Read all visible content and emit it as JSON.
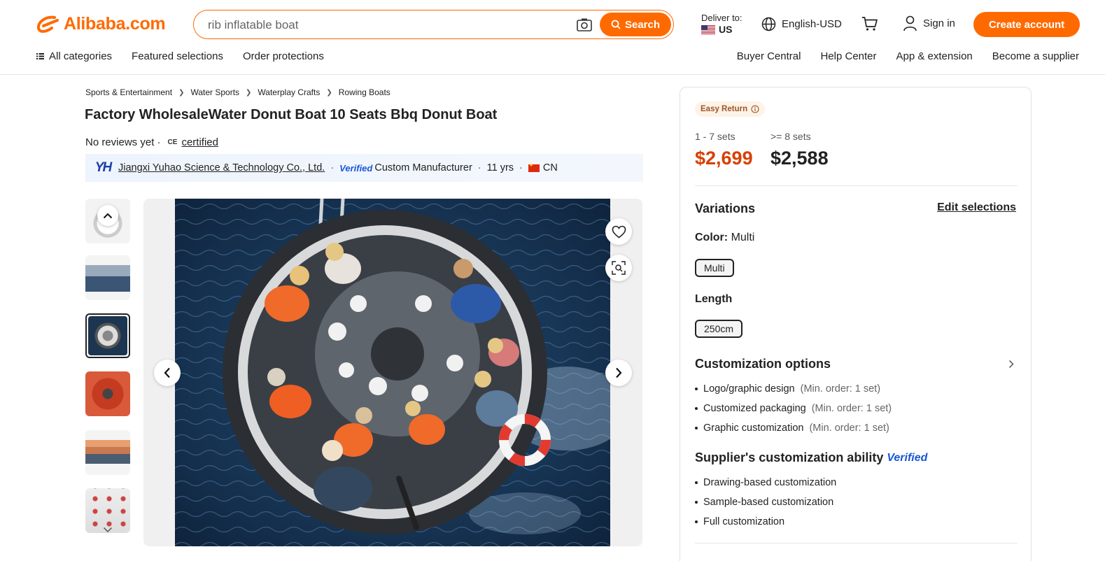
{
  "header": {
    "logo_text": "Alibaba.com",
    "search_placeholder": "rib inflatable boat",
    "search_button": "Search",
    "deliver_label": "Deliver to:",
    "deliver_country": "US",
    "language": "English-USD",
    "sign_in": "Sign in",
    "create_account": "Create account",
    "accent_color": "#ff6a00"
  },
  "nav": {
    "left": [
      "All categories",
      "Featured selections",
      "Order protections"
    ],
    "right": [
      "Buyer Central",
      "Help Center",
      "App & extension",
      "Become a supplier"
    ]
  },
  "breadcrumb": [
    "Sports & Entertainment",
    "Water Sports",
    "Waterplay Crafts",
    "Rowing Boats"
  ],
  "product": {
    "title": "Factory WholesaleWater Donut Boat 10 Seats Bbq Donut Boat",
    "reviews": "No reviews yet ·",
    "cert_mark": "CE",
    "certified": "certified"
  },
  "supplier": {
    "logo_text": "YH",
    "name": "Jiangxi Yuhao Science & Technology Co., Ltd.",
    "verified": "Verified",
    "type": "Custom Manufacturer",
    "years": "11 yrs",
    "country": "CN"
  },
  "panel": {
    "badge": "Easy Return",
    "tiers": [
      {
        "range": "1 - 7 sets",
        "price": "$2,699",
        "color": "#d64000"
      },
      {
        "range": ">= 8 sets",
        "price": "$2,588",
        "color": "#222222"
      }
    ],
    "variations_title": "Variations",
    "edit_selections": "Edit selections",
    "color_label": "Color:",
    "color_value": "Multi",
    "color_chip": "Multi",
    "length_label": "Length",
    "length_chip": "250cm",
    "customization_title": "Customization options",
    "customization_items": [
      {
        "name": "Logo/graphic design",
        "note": "(Min. order: 1 set)"
      },
      {
        "name": "Customized packaging",
        "note": "(Min. order: 1 set)"
      },
      {
        "name": "Graphic customization",
        "note": "(Min. order: 1 set)"
      }
    ],
    "ability_title": "Supplier's customization ability",
    "ability_verified": "Verified",
    "ability_items": [
      "Drawing-based customization",
      "Sample-based customization",
      "Full customization"
    ]
  }
}
